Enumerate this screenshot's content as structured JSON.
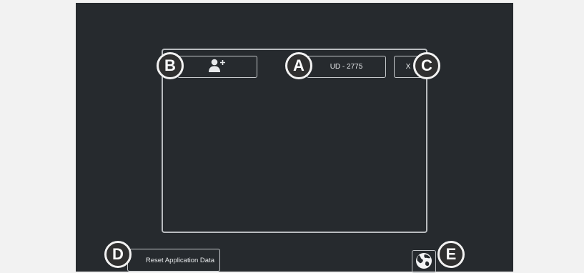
{
  "device_screen": {
    "add_user_icon": "add-user-icon",
    "device_id_label": "UD - 2775",
    "close_label": "X",
    "reset_label": "Reset Application Data",
    "language_icon": "globe-icon"
  },
  "callouts": {
    "a": "A",
    "b": "B",
    "c": "C",
    "d": "D",
    "e": "E"
  },
  "colors": {
    "screen_background": "#262a2e",
    "border": "#c6c9cc",
    "callout_fill": "#303030",
    "page_background": "#f2f2f2"
  }
}
